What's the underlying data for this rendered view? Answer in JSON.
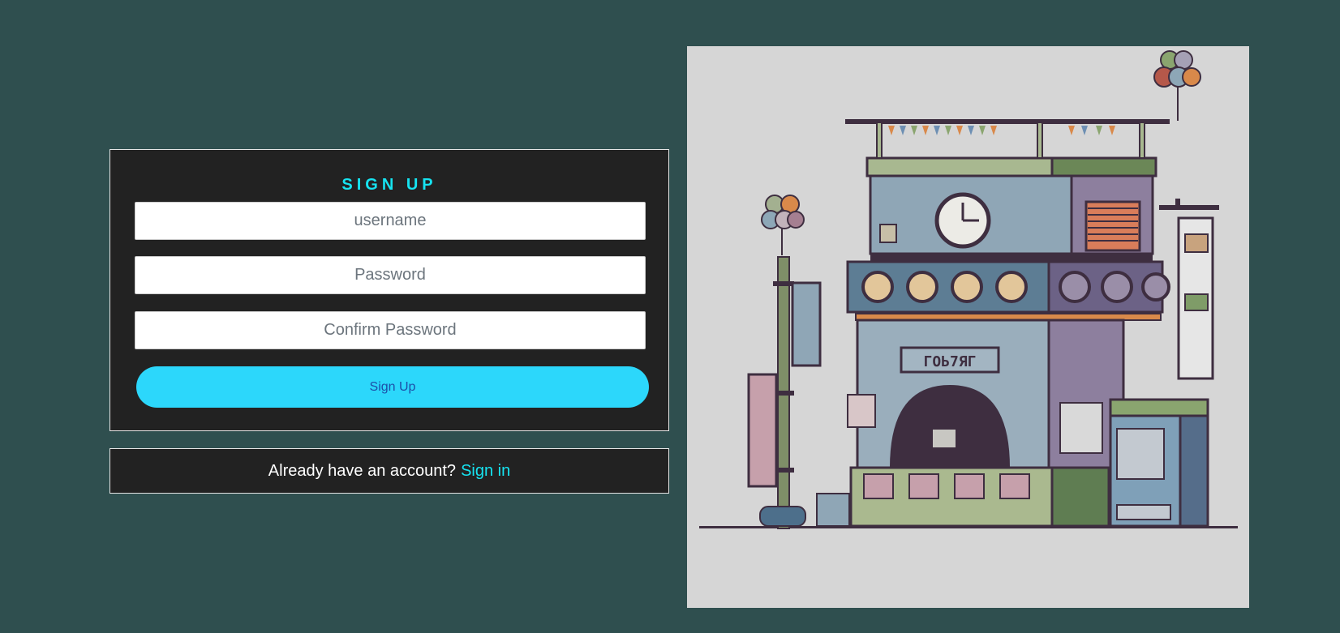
{
  "signup": {
    "title": "SIGN UP",
    "username_placeholder": "username",
    "password_placeholder": "Password",
    "confirm_password_placeholder": "Confirm Password",
    "button_label": "Sign Up"
  },
  "signin": {
    "prompt": "Already have an account?",
    "link_label": "Sign in"
  },
  "illustration": {
    "shop_sign": "ГОЬ7ЯГ",
    "description_icon": "pixel-art-shop-image"
  },
  "colors": {
    "background": "#2f4f4f",
    "card": "#222222",
    "accent": "#16e3f0",
    "button": "#2cd7fb"
  }
}
